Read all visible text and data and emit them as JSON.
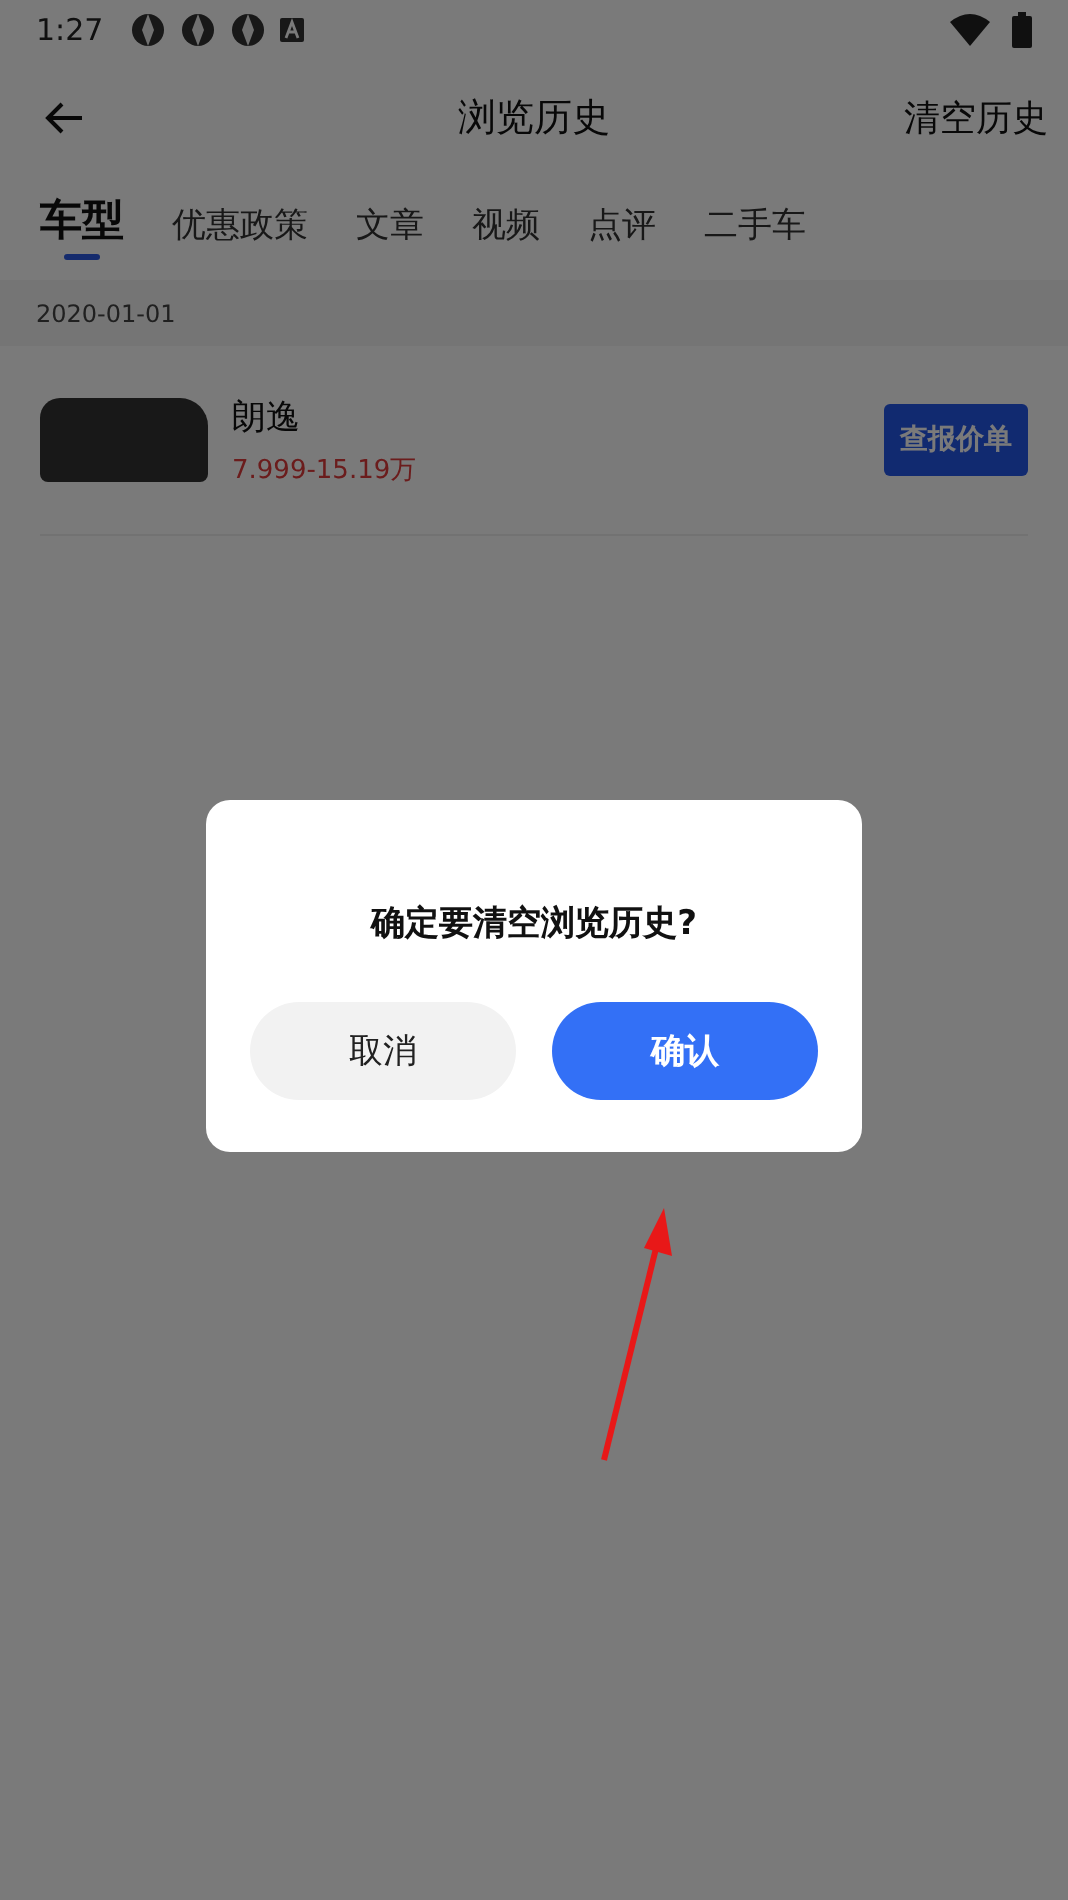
{
  "status_bar": {
    "time": "1:27"
  },
  "header": {
    "title": "浏览历史",
    "action": "清空历史"
  },
  "tabs": [
    {
      "label": "车型",
      "selected": true
    },
    {
      "label": "优惠政策",
      "selected": false
    },
    {
      "label": "文章",
      "selected": false
    },
    {
      "label": "视频",
      "selected": false
    },
    {
      "label": "点评",
      "selected": false
    },
    {
      "label": "二手车",
      "selected": false
    }
  ],
  "history": [
    {
      "date": "2020-01-01",
      "items": [
        {
          "name": "朗逸",
          "price": "7.999-15.19万",
          "button": "查报价单"
        }
      ]
    }
  ],
  "dialog": {
    "message": "确定要清空浏览历史?",
    "cancel": "取消",
    "confirm": "确认"
  }
}
